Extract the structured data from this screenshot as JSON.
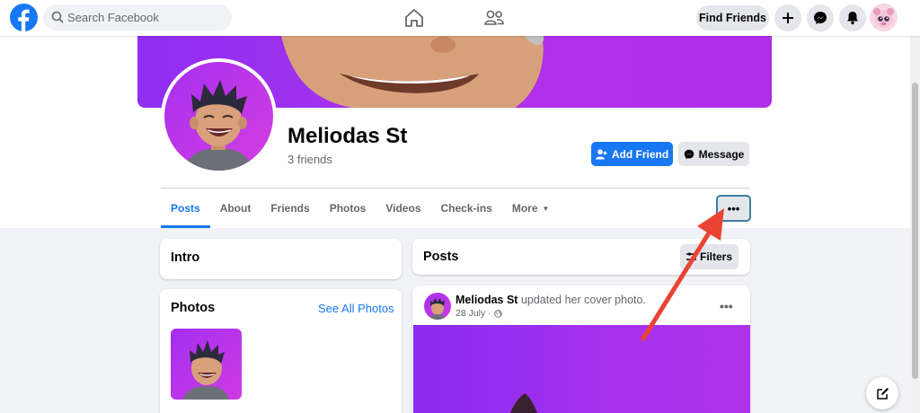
{
  "topbar": {
    "search_placeholder": "Search Facebook",
    "find_friends_label": "Find Friends",
    "icons": [
      "facebook-logo",
      "search-icon",
      "home-icon",
      "friends-icon",
      "plus-icon",
      "messenger-icon",
      "notifications-icon",
      "account-avatar"
    ]
  },
  "profile": {
    "name": "Meliodas St",
    "friends_count": "3 friends",
    "add_friend_label": "Add Friend",
    "message_label": "Message",
    "more_options_label": "•••"
  },
  "tabs": [
    {
      "label": "Posts",
      "active": true
    },
    {
      "label": "About",
      "active": false
    },
    {
      "label": "Friends",
      "active": false
    },
    {
      "label": "Photos",
      "active": false
    },
    {
      "label": "Videos",
      "active": false
    },
    {
      "label": "Check-ins",
      "active": false
    },
    {
      "label": "More",
      "active": false
    }
  ],
  "intro": {
    "title": "Intro"
  },
  "photos": {
    "title": "Photos",
    "see_all_label": "See All Photos"
  },
  "posts": {
    "title": "Posts",
    "filters_label": "Filters",
    "post": {
      "author": "Meliodas St",
      "action": " updated her cover photo.",
      "date": "28 July ·",
      "menu_label": "•••"
    }
  },
  "colors": {
    "brand": "#1877f2",
    "cover": "#a530ee",
    "annotation_arrow": "#ea4335"
  }
}
